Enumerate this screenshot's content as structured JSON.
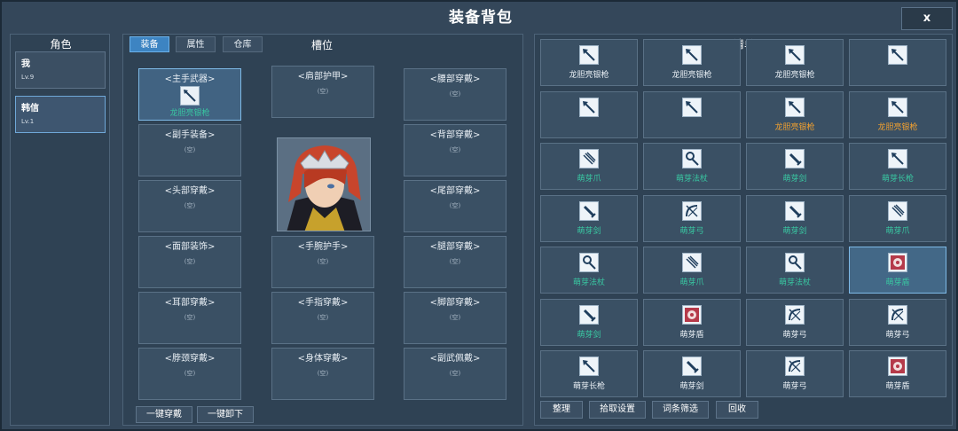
{
  "window": {
    "title": "装备背包",
    "close_label": "x"
  },
  "roles": {
    "title": "角色",
    "items": [
      {
        "name": "我",
        "level": "Lv.9"
      },
      {
        "name": "韩信",
        "level": "Lv.1"
      }
    ]
  },
  "equip": {
    "tabs": [
      "装备",
      "属性",
      "仓库"
    ],
    "title": "槽位",
    "slots": [
      {
        "label": "<主手武器>",
        "item": "龙胆亮银枪",
        "icon": "spear-icon"
      },
      {
        "label": "<副手装备>",
        "empty": "(空)"
      },
      {
        "label": "<头部穿戴>",
        "empty": "(空)"
      },
      {
        "label": "<面部装饰>",
        "empty": "(空)"
      },
      {
        "label": "<耳部穿戴>",
        "empty": "(空)"
      },
      {
        "label": "<脖颈穿戴>",
        "empty": "(空)"
      },
      {
        "label": "<肩部护甲>",
        "empty": "(空)"
      },
      {
        "label": "<手腕护手>",
        "empty": "(空)"
      },
      {
        "label": "<手指穿戴>",
        "empty": "(空)"
      },
      {
        "label": "<身体穿戴>",
        "empty": "(空)"
      },
      {
        "label": "<腰部穿戴>",
        "empty": "(空)"
      },
      {
        "label": "<背部穿戴>",
        "empty": "(空)"
      },
      {
        "label": "<尾部穿戴>",
        "empty": "(空)"
      },
      {
        "label": "<腿部穿戴>",
        "empty": "(空)"
      },
      {
        "label": "<脚部穿戴>",
        "empty": "(空)"
      },
      {
        "label": "<副武佩戴>",
        "empty": "(空)"
      }
    ],
    "buttons": {
      "equip_all": "一键穿戴",
      "unequip_all": "一键卸下"
    }
  },
  "inventory": {
    "title": "清单",
    "colors": {
      "white": "#e8eef4",
      "green": "#39c6a1",
      "orange": "#f0a030"
    },
    "items": [
      {
        "name": "龙胆亮银枪",
        "rarity": "white",
        "icon": "spear-icon"
      },
      {
        "name": "龙胆亮银枪",
        "rarity": "white",
        "icon": "spear-icon"
      },
      {
        "name": "龙胆亮银枪",
        "rarity": "white",
        "icon": "spear-icon"
      },
      {
        "name": "",
        "rarity": "white",
        "icon": "spear-icon"
      },
      {
        "name": "",
        "rarity": "white",
        "icon": "spear-icon"
      },
      {
        "name": "",
        "rarity": "white",
        "icon": "spear-icon"
      },
      {
        "name": "龙胆亮银枪",
        "rarity": "orange",
        "icon": "spear-icon"
      },
      {
        "name": "龙胆亮银枪",
        "rarity": "orange",
        "icon": "spear-icon"
      },
      {
        "name": "萌芽爪",
        "rarity": "green",
        "icon": "claw-icon"
      },
      {
        "name": "萌芽法杖",
        "rarity": "green",
        "icon": "staff-icon"
      },
      {
        "name": "萌芽剑",
        "rarity": "green",
        "icon": "sword-icon"
      },
      {
        "name": "萌芽长枪",
        "rarity": "green",
        "icon": "spear-icon"
      },
      {
        "name": "萌芽剑",
        "rarity": "green",
        "icon": "sword-icon"
      },
      {
        "name": "萌芽弓",
        "rarity": "green",
        "icon": "bow-icon"
      },
      {
        "name": "萌芽剑",
        "rarity": "green",
        "icon": "sword-icon"
      },
      {
        "name": "萌芽爪",
        "rarity": "green",
        "icon": "claw-icon"
      },
      {
        "name": "萌芽法杖",
        "rarity": "green",
        "icon": "staff-icon"
      },
      {
        "name": "萌芽爪",
        "rarity": "green",
        "icon": "claw-icon"
      },
      {
        "name": "萌芽法杖",
        "rarity": "green",
        "icon": "staff-icon"
      },
      {
        "name": "萌芽盾",
        "rarity": "green",
        "icon": "shield-icon"
      },
      {
        "name": "萌芽剑",
        "rarity": "green",
        "icon": "sword-icon"
      },
      {
        "name": "萌芽盾",
        "rarity": "white",
        "icon": "shield-icon"
      },
      {
        "name": "萌芽弓",
        "rarity": "white",
        "icon": "bow-icon"
      },
      {
        "name": "萌芽弓",
        "rarity": "white",
        "icon": "bow-icon"
      },
      {
        "name": "萌芽长枪",
        "rarity": "white",
        "icon": "spear-icon"
      },
      {
        "name": "萌芽剑",
        "rarity": "white",
        "icon": "sword-icon"
      },
      {
        "name": "萌芽弓",
        "rarity": "white",
        "icon": "bow-icon"
      },
      {
        "name": "萌芽盾",
        "rarity": "white",
        "icon": "shield-icon"
      }
    ],
    "buttons": [
      "整理",
      "拾取设置",
      "词条筛选",
      "回收"
    ]
  }
}
